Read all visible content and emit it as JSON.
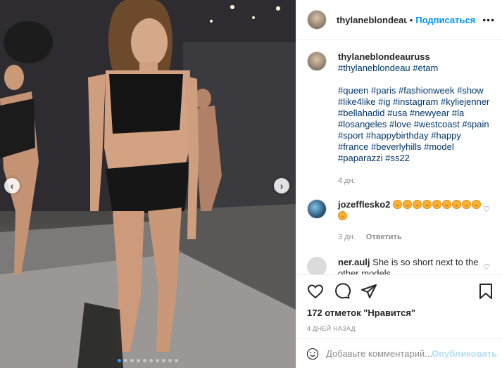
{
  "post": {
    "username": "thylaneblondeauru",
    "separator": "•",
    "follow_label": "Подписаться",
    "more_icon": "more-horizontal-icon"
  },
  "caption": {
    "username": "thylaneblondeauruss",
    "first_line": "#thylaneblondeau #etam",
    "hashtags": "#queen #paris #fashionweek #show #like4like #ig #instagram #kyliejenner #bellahadid #usa #newyear #la #losangeles #love #westcoast #spain #sport #happybirthday #happy #france #beverlyhills #model #paparazzi #ss22",
    "time": "4 дн."
  },
  "comments": [
    {
      "username": "jozefflesko2",
      "text": "",
      "emoji_count": 10,
      "time": "3 дн.",
      "reply_label": "Ответить"
    },
    {
      "username": "ner.aulj",
      "text": "She is so short next to the other models"
    }
  ],
  "actions": {
    "likes": "172 отметок \"Нравится\"",
    "date": "4 ДНЕЙ НАЗАД"
  },
  "add_comment": {
    "placeholder": "Добавьте комментарий...",
    "publish_label": "Опубликовать"
  },
  "carousel": {
    "slide_count": 10,
    "active_index": 0
  },
  "colors": {
    "link": "#00376b",
    "follow": "#0095f6",
    "publish_disabled": "#b2dffc",
    "active_dot": "#3897f0"
  }
}
